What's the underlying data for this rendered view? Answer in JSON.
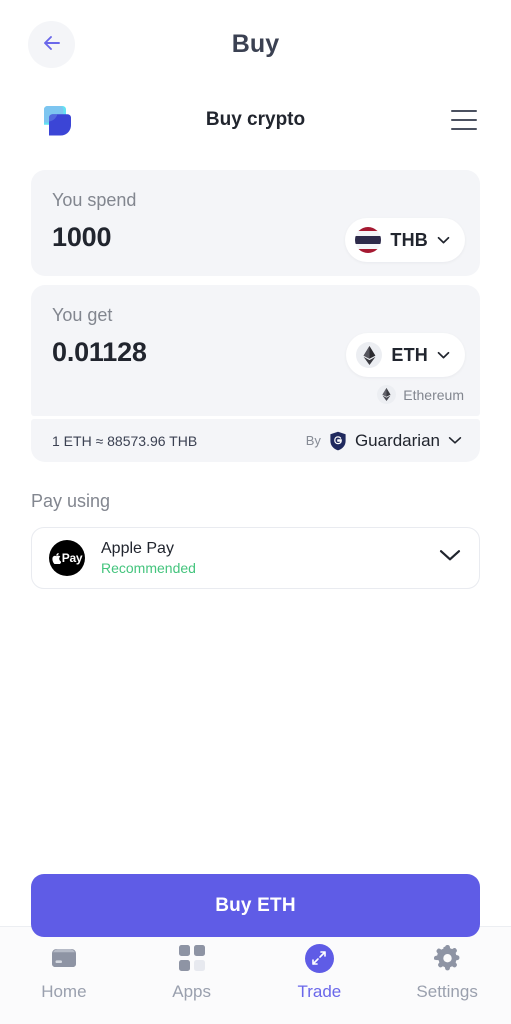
{
  "topbar": {
    "title": "Buy",
    "back_icon": "arrow-left-icon",
    "back_icon_color": "#6a67ea"
  },
  "widget": {
    "title": "Buy crypto",
    "logo_icon": "app-logo-icon",
    "logo_colors": [
      "#5de3f0",
      "#6aa8f0",
      "#3b45d6"
    ],
    "menu_icon": "hamburger-menu-icon"
  },
  "spend": {
    "label": "You spend",
    "amount": "1000",
    "placeholder": "0",
    "currency_code": "THB",
    "currency_flag_icon": "thailand-flag-icon",
    "chevron_icon": "chevron-down-icon"
  },
  "get": {
    "label": "You get",
    "amount": "0.01128",
    "placeholder": "0",
    "currency_code": "ETH",
    "currency_icon": "ethereum-icon",
    "chevron_icon": "chevron-down-icon",
    "network_name": "Ethereum",
    "network_icon": "ethereum-icon"
  },
  "rate": {
    "text": "1 ETH ≈ 88573.96 THB",
    "by_label": "By",
    "provider_name": "Guardarian",
    "provider_icon": "guardarian-shield-icon",
    "provider_icon_color": "#20295e",
    "chevron_icon": "chevron-down-icon"
  },
  "payment": {
    "section_label": "Pay using",
    "method_name": "Apple Pay",
    "method_badge": "Recommended",
    "badge_color": "#44c47d",
    "logo_icon": "apple-pay-icon",
    "logo_apple_glyph": "",
    "logo_text": "Pay",
    "chevron_icon": "chevron-down-icon"
  },
  "cta": {
    "label": "Buy ETH",
    "color": "#5f5ce6"
  },
  "tabbar": {
    "items": [
      {
        "label": "Home",
        "icon": "wallet-icon",
        "active": false
      },
      {
        "label": "Apps",
        "icon": "grid-apps-icon",
        "active": false
      },
      {
        "label": "Trade",
        "icon": "trade-expand-icon",
        "active": true
      },
      {
        "label": "Settings",
        "icon": "gear-icon",
        "active": false
      }
    ],
    "active_color": "#6a67ea",
    "inactive_color": "#9aa0ae"
  }
}
